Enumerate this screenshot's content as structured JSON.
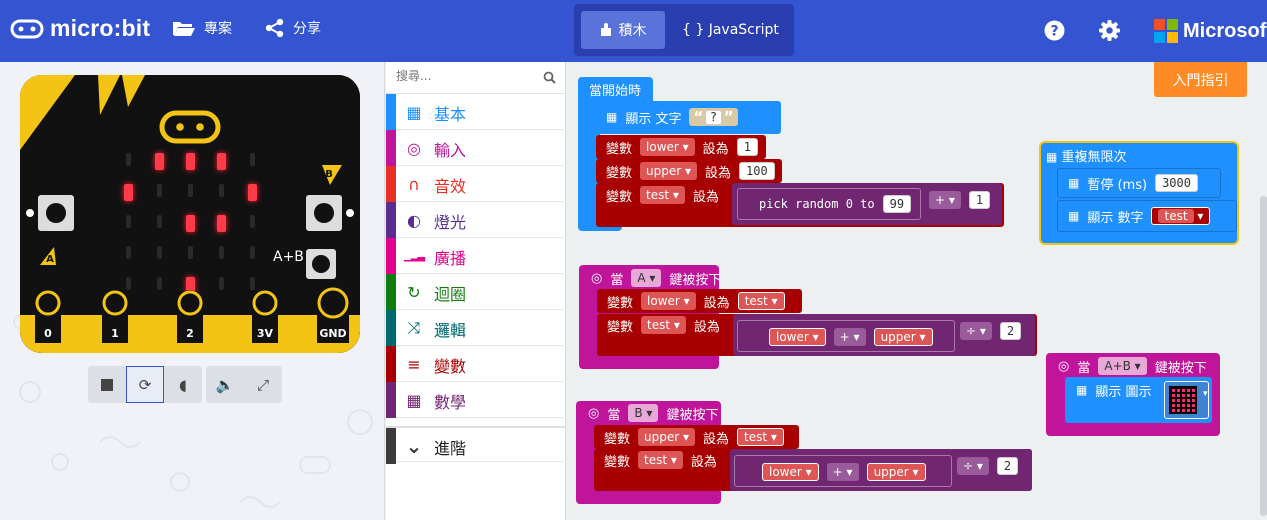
{
  "topbar": {
    "logo_text": "micro:bit",
    "projects_label": "專案",
    "share_label": "分享",
    "blocks_label": "積木",
    "javascript_label": "{ } JavaScript",
    "microsoft_label": "Microsoft",
    "accent": "#3454d1"
  },
  "simulator": {
    "pin_labels": [
      "0",
      "1",
      "2",
      "3V",
      "GND"
    ],
    "button_a": "A",
    "button_b": "B",
    "button_ab": "A+B",
    "controls": [
      "stop-icon",
      "restart-icon",
      "slowmo-icon",
      "mute-icon",
      "fullscreen-icon"
    ]
  },
  "toolbox": {
    "search_placeholder": "搜尋...",
    "categories": [
      {
        "label": "基本",
        "color": "#1e90ff",
        "icon": "grid-icon"
      },
      {
        "label": "輸入",
        "color": "#c0149b",
        "icon": "target-icon"
      },
      {
        "label": "音效",
        "color": "#e63022",
        "icon": "headphones-icon"
      },
      {
        "label": "燈光",
        "color": "#5c2d91",
        "icon": "toggle-icon"
      },
      {
        "label": "廣播",
        "color": "#e3008c",
        "icon": "signal-icon"
      },
      {
        "label": "迴圈",
        "color": "#107c10",
        "icon": "loop-icon"
      },
      {
        "label": "邏輯",
        "color": "#006970",
        "icon": "shuffle-icon"
      },
      {
        "label": "變數",
        "color": "#a80000",
        "icon": "variable-icon"
      },
      {
        "label": "數學",
        "color": "#712672",
        "icon": "calculator-icon"
      },
      {
        "label": "進階",
        "color": "#3c3c3c",
        "icon": "chevron-down-icon"
      }
    ]
  },
  "workspace": {
    "guide_button": "入門指引",
    "on_start": {
      "title": "當開始時",
      "show_text_label": "顯示 文字",
      "show_text_value": "?",
      "set_label": "變數",
      "set_to": "設為",
      "lower_var": "lower",
      "lower_value": "1",
      "upper_var": "upper",
      "upper_value": "100",
      "test_var": "test",
      "pick_random_label": "pick random 0 to",
      "random_max": "99",
      "plus_op": "+",
      "plus_value": "1"
    },
    "forever": {
      "title": "重複無限次",
      "pause_label": "暫停 (ms)",
      "pause_value": "3000",
      "show_number_label": "顯示 數字",
      "show_number_var": "test"
    },
    "on_button_a": {
      "when": "當",
      "button": "A",
      "pressed": "鍵被按下",
      "set_label": "變數",
      "set_to": "設為",
      "var1": "lower",
      "val1": "test",
      "var2": "test",
      "left": "lower",
      "op1": "+",
      "right": "upper",
      "op2": "÷",
      "divisor": "2"
    },
    "on_button_b": {
      "when": "當",
      "button": "B",
      "pressed": "鍵被按下",
      "set_label": "變數",
      "set_to": "設為",
      "var1": "upper",
      "val1": "test",
      "var2": "test",
      "left": "lower",
      "op1": "+",
      "right": "upper",
      "op2": "÷",
      "divisor": "2"
    },
    "on_button_ab": {
      "when": "當",
      "button": "A+B",
      "pressed": "鍵被按下",
      "show_icon_label": "顯示 圖示"
    }
  }
}
